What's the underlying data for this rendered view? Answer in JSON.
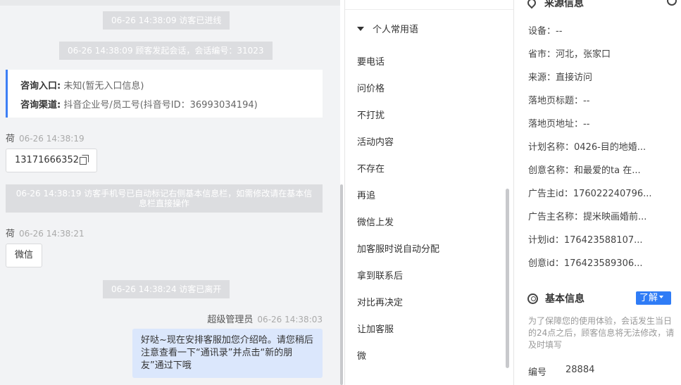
{
  "chat": {
    "system_messages": [
      "06-26 14:38:09 访客已进线",
      "06-26 14:38:09 顾客发起会话，会话编号：31023",
      "06-26 14:38:19 访客手机号已自动标记右侧基本信息栏，如需修改请在基本信息栏直接操作",
      "06-26 14:38:24 访客已离开"
    ],
    "entry_card": {
      "entry_label": "咨询入口:",
      "entry_value": "未知(暂无入口信息)",
      "channel_label": "咨询渠道:",
      "channel_value": "抖音企业号/员工号(抖音号ID：36993034194)"
    },
    "visitor_messages": [
      {
        "sender": "荷",
        "time": "06-26 14:38:19",
        "text": "13171666352"
      },
      {
        "sender": "荷",
        "time": "06-26 14:38:21",
        "text": "微信"
      }
    ],
    "agent_message": {
      "sender": "超级管理员",
      "time": "06-26 14:38:03",
      "text": "好哒~现在安排客服加您介绍哈。请您稍后注意查看一下“通讯录”并点击“新的朋友”通过下哦"
    }
  },
  "phrases": {
    "group_label": "个人常用语",
    "items": [
      "要电话",
      "问价格",
      "不打扰",
      "活动内容",
      "不存在",
      "再追",
      "微信上发",
      "加客服时说自动分配",
      "拿到联系后",
      "对比再决定",
      "让加客服",
      "微"
    ]
  },
  "info": {
    "source_title": "来源信息",
    "rows": [
      "设备：--",
      "省市：河北，张家口",
      "来源：直接访问",
      "落地页标题：--",
      "落地页地址：--",
      "计划名称：0426-目的地婚...",
      "创意名称：和最爱的ta 在...",
      "广告主id：176022240796...",
      "广告主名称：提米映画婚前...",
      "计划id：176423588107...",
      "创意id：176423589306..."
    ],
    "basic_title": "基本信息",
    "learn_button": "了解",
    "notice": "为了保障您的使用体验，会话发生当日的24点之后，顾客信息将无法修改，请及时填写",
    "id_label": "编号",
    "id_value": "28884"
  }
}
